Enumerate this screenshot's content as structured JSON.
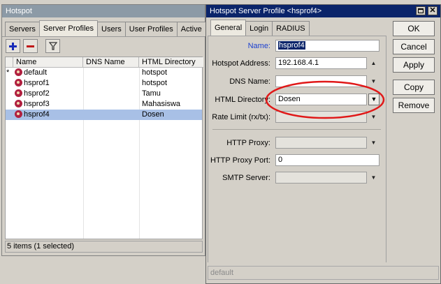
{
  "hotspot_window": {
    "title": "Hotspot",
    "tabs": [
      "Servers",
      "Server Profiles",
      "Users",
      "User Profiles",
      "Active"
    ],
    "active_tab": 1,
    "columns": [
      "Name",
      "DNS Name",
      "HTML Directory"
    ],
    "rows": [
      {
        "marker": "*",
        "name": "default",
        "dns": "",
        "html_dir": "hotspot",
        "selected": false
      },
      {
        "marker": "",
        "name": "hsprof1",
        "dns": "",
        "html_dir": "hotspot",
        "selected": false
      },
      {
        "marker": "",
        "name": "hsprof2",
        "dns": "",
        "html_dir": "Tamu",
        "selected": false
      },
      {
        "marker": "",
        "name": "hsprof3",
        "dns": "",
        "html_dir": "Mahasiswa",
        "selected": false
      },
      {
        "marker": "",
        "name": "hsprof4",
        "dns": "",
        "html_dir": "Dosen",
        "selected": true
      }
    ],
    "status": "5 items (1 selected)",
    "toolbar_icons": [
      "add-icon",
      "remove-icon",
      "filter-icon"
    ]
  },
  "profile_dialog": {
    "title": "Hotspot Server Profile <hsprof4>",
    "tabs": [
      "General",
      "Login",
      "RADIUS"
    ],
    "active_tab": 0,
    "fields": {
      "name": {
        "label": "Name:",
        "value": "hsprof4"
      },
      "hotspot_address": {
        "label": "Hotspot Address:",
        "value": "192.168.4.1"
      },
      "dns_name": {
        "label": "DNS Name:",
        "value": ""
      },
      "html_directory": {
        "label": "HTML Directory:",
        "value": "Dosen"
      },
      "rate_limit": {
        "label": "Rate Limit (rx/tx):",
        "value": ""
      },
      "http_proxy": {
        "label": "HTTP Proxy:",
        "value": ""
      },
      "http_proxy_port": {
        "label": "HTTP Proxy Port:",
        "value": "0"
      },
      "smtp_server": {
        "label": "SMTP Server:",
        "value": ""
      }
    },
    "buttons": {
      "ok": "OK",
      "cancel": "Cancel",
      "apply": "Apply",
      "copy": "Copy",
      "remove": "Remove"
    },
    "status": "default"
  },
  "colors": {
    "titlebar_inactive": "#8c9aa6",
    "titlebar_active": "#0a246a",
    "selection": "#a8c0e6",
    "highlight_ellipse": "#e01818",
    "name_label": "#1a3fd0"
  }
}
